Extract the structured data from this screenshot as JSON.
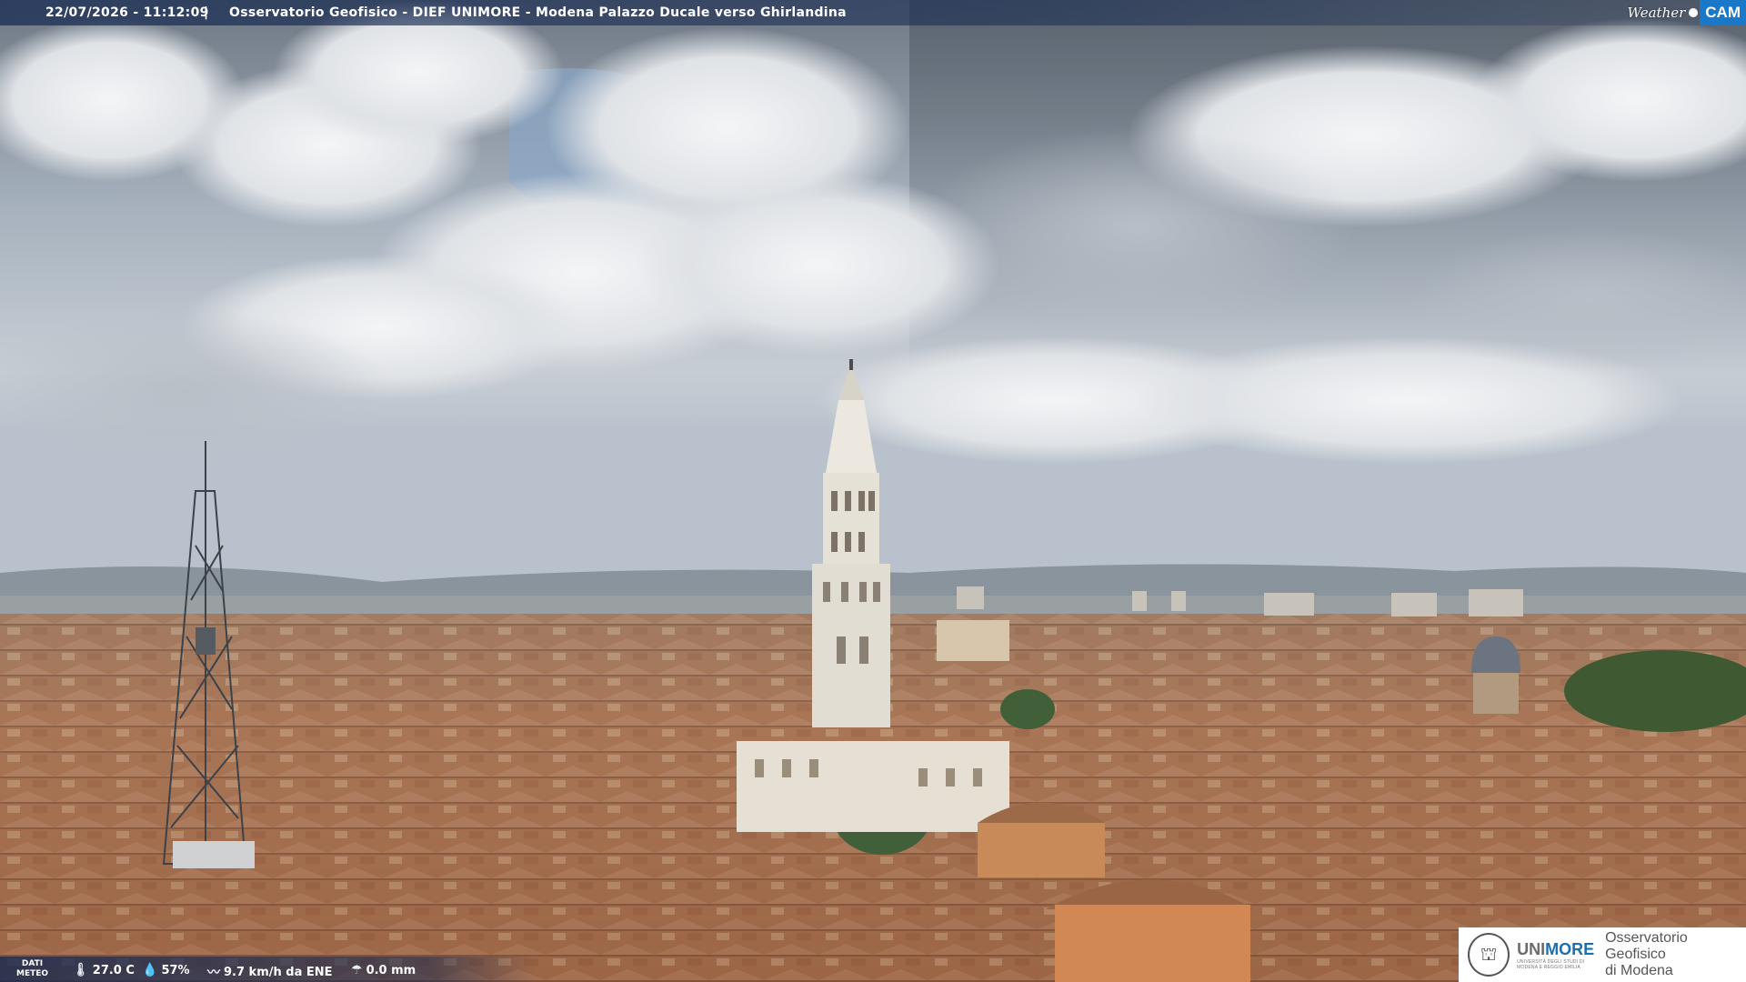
{
  "banner": {
    "datetime": "22/07/2026 - 11:12:09",
    "separator": "|",
    "title": "Osservatorio Geofisico - DIEF UNIMORE - Modena Palazzo Ducale verso Ghirlandina"
  },
  "brand": {
    "weather": "Weather",
    "cam": "CAM",
    "accent_color": "#1a78c8"
  },
  "meteo": {
    "label_line1": "DATI",
    "label_line2": "METEO",
    "temperature": "27.0 C",
    "temperature_icon": "thermometer-icon",
    "humidity": "57%",
    "humidity_icon": "droplet-icon",
    "wind": "9.7 km/h da ENE",
    "wind_icon": "wind-icon",
    "rain": "0.0 mm",
    "rain_icon": "rain-gauge-icon"
  },
  "logo": {
    "uni_prefix": "UNI",
    "uni_suffix": "MORE",
    "uni_sub1": "UNIVERSITÀ DEGLI STUDI DI",
    "uni_sub2": "MODENA E REGGIO EMILIA",
    "observatory_line1": "Osservatorio Geofisico",
    "observatory_line2": "di Modena"
  }
}
